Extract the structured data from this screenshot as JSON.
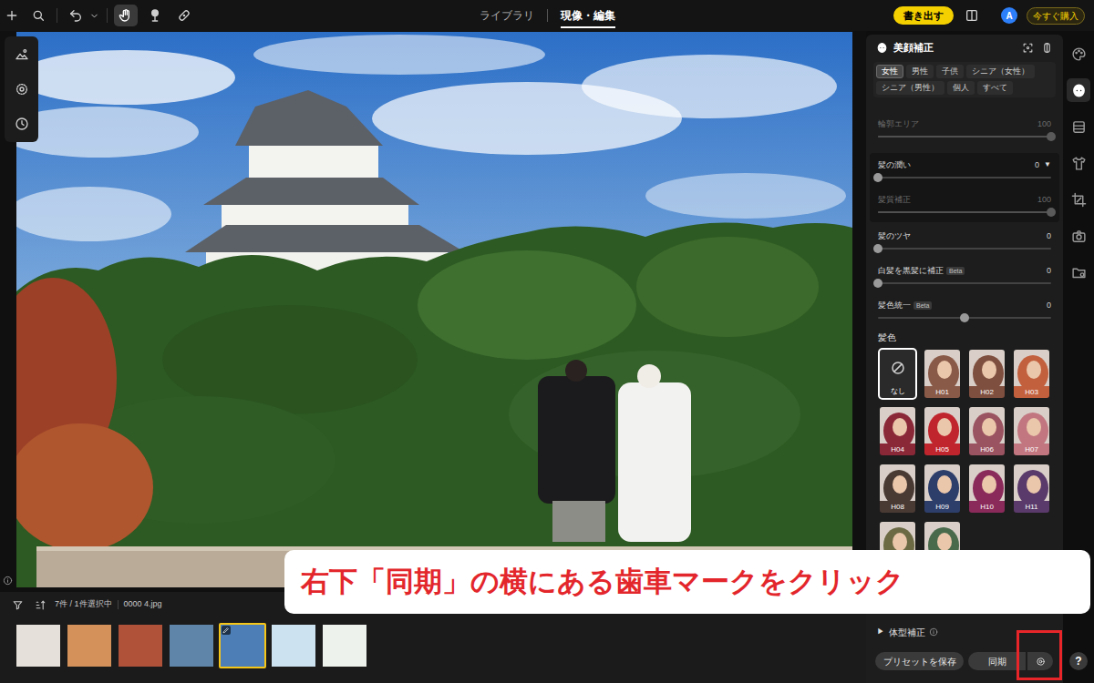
{
  "top_bar": {
    "tools": [
      {
        "selected": false
      },
      {
        "selected": false
      },
      {
        "selected": false
      },
      {
        "selected": false
      },
      {
        "selected": true
      },
      {
        "selected": false
      },
      {
        "selected": false
      }
    ],
    "nav_tabs": [
      {
        "label": "ライブラリ",
        "selected": false
      },
      {
        "label": "現像・編集",
        "selected": true
      }
    ],
    "export_button": "書き出す",
    "avatar": "A",
    "buy_button": "今すぐ購入"
  },
  "canvas_tools": [
    {
      "selected": false
    },
    {
      "selected": false
    },
    {
      "selected": false
    }
  ],
  "filmstrip": {
    "count": "7件 / 1件選択中",
    "filename": "0000 4.jpg",
    "thumbnails": [
      {
        "selected": false,
        "edited": false,
        "color": "#e6e0da"
      },
      {
        "selected": false,
        "edited": false,
        "color": "#d4925a"
      },
      {
        "selected": false,
        "edited": false,
        "color": "#b0523a"
      },
      {
        "selected": false,
        "edited": false,
        "color": "#5f86a8"
      },
      {
        "selected": true,
        "edited": true,
        "color": "#4d7fb6"
      },
      {
        "selected": false,
        "edited": false,
        "color": "#cde2f0"
      },
      {
        "selected": false,
        "edited": false,
        "color": "#eef2ec"
      }
    ]
  },
  "panel": {
    "title": "美顔補正",
    "presets": [
      {
        "label": "女性",
        "selected": true
      },
      {
        "label": "男性",
        "selected": false
      },
      {
        "label": "子供",
        "selected": false
      },
      {
        "label": "シニア（女性）",
        "selected": false
      },
      {
        "label": "シニア（男性）",
        "selected": false
      },
      {
        "label": "個人",
        "selected": false
      },
      {
        "label": "すべて",
        "selected": false
      }
    ],
    "slider_groups": [
      {
        "boxed": false,
        "rows": [
          {
            "label": "輪郭エリア",
            "value": "100",
            "level": 1,
            "disabled": true,
            "kind": "normal"
          }
        ]
      },
      {
        "boxed": true,
        "rows": [
          {
            "label": "髪の潤い",
            "value": "0",
            "menu": "▼",
            "level": 0,
            "disabled": false,
            "kind": "normal"
          },
          {
            "label": "髪質補正",
            "value": "100",
            "level": 1,
            "disabled": true,
            "kind": "normal"
          }
        ]
      },
      {
        "boxed": false,
        "rows": [
          {
            "label": "髪のツヤ",
            "value": "0",
            "level": 0,
            "disabled": false,
            "kind": "normal"
          },
          {
            "label": "白髪を黒髪に補正",
            "badge": "Beta",
            "value": "0",
            "level": 0,
            "disabled": false,
            "kind": "normal"
          },
          {
            "label": "髪色統一",
            "badge": "Beta",
            "value": "0",
            "level": 0.5,
            "disabled": false,
            "kind": "centered"
          }
        ]
      }
    ],
    "hair_color": {
      "title": "髪色",
      "swatches": [
        {
          "kind": "none",
          "label": "なし",
          "selected": true
        },
        {
          "kind": "color",
          "label": "H01",
          "color": "#8a5a48",
          "selected": false
        },
        {
          "kind": "color",
          "label": "H02",
          "color": "#7e4e3e",
          "selected": false
        },
        {
          "kind": "color",
          "label": "H03",
          "color": "#c2603e",
          "selected": false
        },
        {
          "kind": "color",
          "label": "H04",
          "color": "#8a2838",
          "selected": false
        },
        {
          "kind": "color",
          "label": "H05",
          "color": "#c0252d",
          "selected": false
        },
        {
          "kind": "color",
          "label": "H06",
          "color": "#9a5360",
          "selected": false
        },
        {
          "kind": "color",
          "label": "H07",
          "color": "#c27780",
          "selected": false
        },
        {
          "kind": "color",
          "label": "H08",
          "color": "#4a3a34",
          "selected": false
        },
        {
          "kind": "color",
          "label": "H09",
          "color": "#2e3e6a",
          "selected": false
        },
        {
          "kind": "color",
          "label": "H10",
          "color": "#8a2a5a",
          "selected": false
        },
        {
          "kind": "color",
          "label": "H11",
          "color": "#5a3a6a",
          "selected": false
        },
        {
          "kind": "color",
          "color": "#6b6a45",
          "selected": false
        },
        {
          "kind": "color",
          "color": "#4a6a4c",
          "selected": false
        }
      ]
    },
    "body_section": {
      "arrow": "▶",
      "label": "体型補正",
      "expanded": false
    },
    "buttons": {
      "save_preset": "プリセットを保存",
      "sync": "同期"
    }
  },
  "side_tools": [
    {
      "selected": false
    },
    {
      "selected": true
    },
    {
      "selected": false
    },
    {
      "selected": false
    },
    {
      "selected": false
    },
    {
      "selected": false
    },
    {
      "selected": false
    }
  ],
  "help_button": "?",
  "annotation": {
    "text": "右下「同期」の横にある歯車マークをクリック",
    "highlight": true
  }
}
